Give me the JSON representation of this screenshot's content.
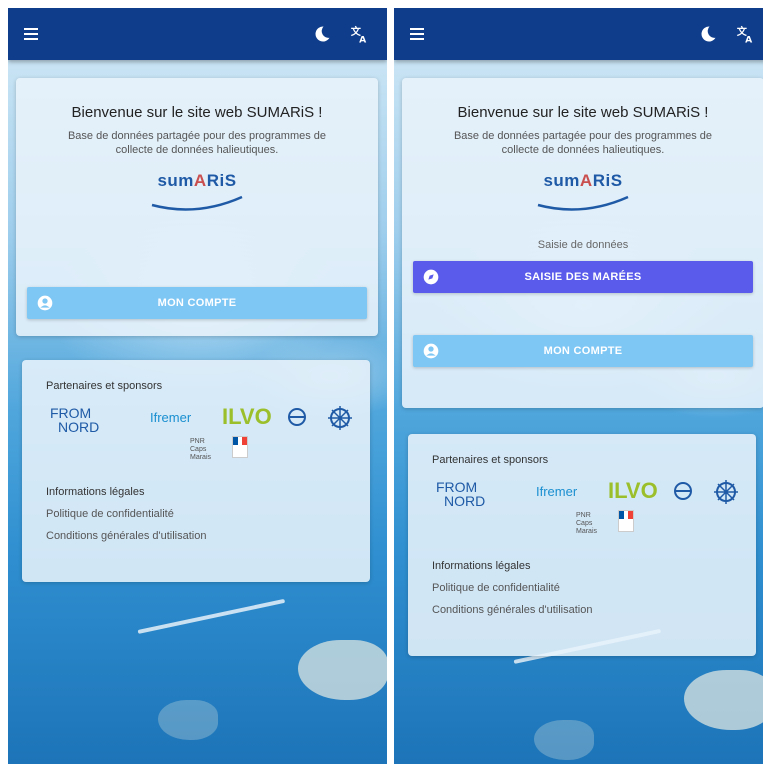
{
  "screens": [
    {
      "id": "left",
      "welcome": {
        "title": "Bienvenue sur le site web SUMARiS !",
        "subtitle_line1": "Base de données partagée pour des programmes de",
        "subtitle_line2": "collecte de données halieutiques."
      },
      "logo_text": {
        "part1": "sum",
        "part2": "A",
        "part3": "RiS"
      },
      "account_button": "MON COMPTE",
      "partners_title": "Partenaires et sponsors",
      "legal_title": "Informations légales",
      "privacy_link": "Politique de confidentialité",
      "terms_link": "Conditions générales d'utilisation"
    },
    {
      "id": "right",
      "welcome": {
        "title": "Bienvenue sur le site web SUMARiS !",
        "subtitle_line1": "Base de données partagée pour des programmes de",
        "subtitle_line2": "collecte de données halieutiques."
      },
      "logo_text": {
        "part1": "sum",
        "part2": "A",
        "part3": "RiS"
      },
      "data_entry_label": "Saisie de données",
      "saisie_button": "SAISIE DES MARÉES",
      "account_button": "MON COMPTE",
      "partners_title": "Partenaires et sponsors",
      "legal_title": "Informations légales",
      "privacy_link": "Politique de confidentialité",
      "terms_link": "Conditions générales d'utilisation"
    }
  ],
  "partner_logos": {
    "from_nord_1": "FROM",
    "from_nord_2": "NORD",
    "ifremer": "Ifremer",
    "ilvo": "ILVO",
    "nausicaa": "Nausicaá",
    "pnr": "PNR Caps Marais"
  },
  "icons": {
    "menu": "menu-icon",
    "theme": "moon-icon",
    "translate": "translate-icon",
    "account": "account-circle-icon",
    "saisie": "compass-icon"
  },
  "colors": {
    "appbar": "#0f3d8c",
    "account_button": "#7ec6f4",
    "saisie_button": "#5a5bea",
    "logo_blue": "#1f5aa6"
  }
}
